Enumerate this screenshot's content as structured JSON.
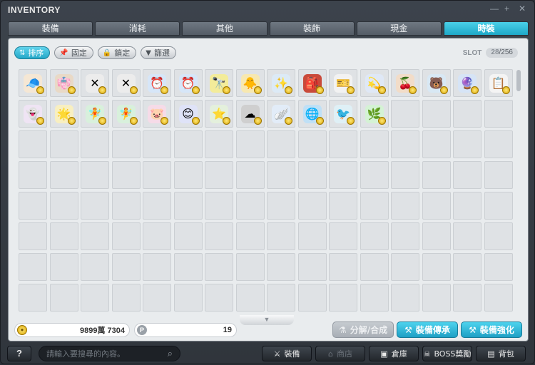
{
  "window": {
    "title": "INVENTORY"
  },
  "tabs": [
    {
      "label": "裝備",
      "active": false
    },
    {
      "label": "消耗",
      "active": false
    },
    {
      "label": "其他",
      "active": false
    },
    {
      "label": "裝飾",
      "active": false
    },
    {
      "label": "現金",
      "active": false
    },
    {
      "label": "時裝",
      "active": true
    }
  ],
  "toolbar": {
    "sort": {
      "label": "排序",
      "icon": "sort-icon"
    },
    "pin": {
      "label": "固定",
      "icon": "pin-icon"
    },
    "lock": {
      "label": "鎖定",
      "icon": "lock-icon"
    },
    "filter": {
      "label": "篩選",
      "icon": "filter-icon"
    }
  },
  "slot": {
    "label": "SLOT",
    "used": "28",
    "total": "/256"
  },
  "items": [
    {
      "icon": "cap-icon",
      "glyph": "🧢",
      "bg": "#f5e7d4"
    },
    {
      "icon": "robe-icon",
      "glyph": "👘",
      "bg": "#e9d9c6"
    },
    {
      "icon": "crossed-poles-icon",
      "glyph": "✕",
      "bg": "#ececec"
    },
    {
      "icon": "crossed-poles-icon",
      "glyph": "✕",
      "bg": "#ececec"
    },
    {
      "icon": "alarm-clock-icon",
      "glyph": "⏰",
      "bg": "#d6e6f8"
    },
    {
      "icon": "alarm-clock-icon",
      "glyph": "⏰",
      "bg": "#d6e6f8"
    },
    {
      "icon": "binoculars-icon",
      "glyph": "🔭",
      "bg": "#f3ec9a"
    },
    {
      "icon": "duck-icon",
      "glyph": "🐥",
      "bg": "#f7e8b0"
    },
    {
      "icon": "sparkle-icon",
      "glyph": "✨",
      "bg": "#dceaf6"
    },
    {
      "icon": "red-robe-icon",
      "glyph": "🎒",
      "bg": "#c94a3a"
    },
    {
      "icon": "ticket-icon",
      "glyph": "🎫",
      "bg": "#f2f2f2"
    },
    {
      "icon": "blue-ring-icon",
      "glyph": "💫",
      "bg": "#dfe8f6"
    },
    {
      "icon": "berries-icon",
      "glyph": "🍒",
      "bg": "#f2dcc8"
    },
    {
      "icon": "blue-creature-icon",
      "glyph": "🐻",
      "bg": "#d8e8f4"
    },
    {
      "icon": "water-orb-icon",
      "glyph": "🔮",
      "bg": "#d6e4f6"
    },
    {
      "icon": "clipboard-icon",
      "glyph": "📋",
      "bg": "#f4f4f4"
    },
    {
      "icon": "ghost-icon",
      "glyph": "👻",
      "bg": "#efe4f4"
    },
    {
      "icon": "glow-orb-icon",
      "glyph": "🌟",
      "bg": "#f8efc0"
    },
    {
      "icon": "green-figure-icon",
      "glyph": "🧚",
      "bg": "#d8f0dc"
    },
    {
      "icon": "green-figure-icon",
      "glyph": "🧚",
      "bg": "#d8f0dc"
    },
    {
      "icon": "pink-pig-icon",
      "glyph": "🐷",
      "bg": "#f6dbe8"
    },
    {
      "icon": "blue-face-icon",
      "glyph": "😊",
      "bg": "#dfe3f8"
    },
    {
      "icon": "stars-icon",
      "glyph": "⭐",
      "bg": "#e4f0dc"
    },
    {
      "icon": "black-cloud-icon",
      "glyph": "☁",
      "bg": "#cfcfcf"
    },
    {
      "icon": "wings-icon",
      "glyph": "🪽",
      "bg": "#e2ecf8"
    },
    {
      "icon": "blue-orb-icon",
      "glyph": "🌐",
      "bg": "#bfe0f6"
    },
    {
      "icon": "blue-bird-icon",
      "glyph": "🐦",
      "bg": "#dff0f6"
    },
    {
      "icon": "green-wings-icon",
      "glyph": "🌿",
      "bg": "#d4f2d4"
    }
  ],
  "currency": {
    "meso": "9899萬 7304",
    "points": "19"
  },
  "actions": {
    "disassemble": "分解/合成",
    "transfer": "裝備傳承",
    "enhance": "裝備強化"
  },
  "bottom": {
    "help": "?",
    "search_placeholder": "請輸入要搜尋的內容。",
    "equip": "裝備",
    "shop": "商店",
    "storage": "倉庫",
    "boss_reward": "BOSS獎勵",
    "bag": "背包"
  },
  "colors": {
    "accent": "#1ea8c8",
    "panel": "#e9ecee",
    "frame": "#3c434c"
  }
}
